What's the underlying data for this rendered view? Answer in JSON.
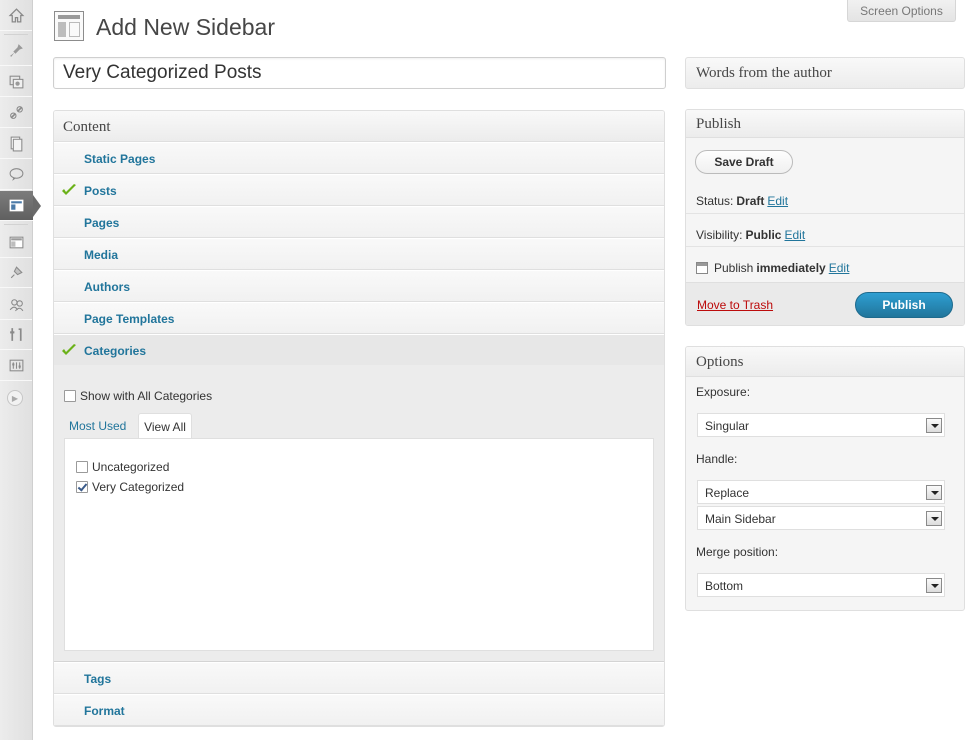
{
  "header": {
    "title": "Add New Sidebar",
    "screen_options": "Screen Options"
  },
  "title_input": {
    "value": "Very Categorized Posts"
  },
  "content_box": {
    "title": "Content",
    "rows": [
      {
        "label": "Static Pages",
        "checked": false
      },
      {
        "label": "Posts",
        "checked": true
      },
      {
        "label": "Pages",
        "checked": false
      },
      {
        "label": "Media",
        "checked": false
      },
      {
        "label": "Authors",
        "checked": false
      },
      {
        "label": "Page Templates",
        "checked": false
      },
      {
        "label": "Categories",
        "checked": true
      },
      {
        "label": "Tags",
        "checked": false
      },
      {
        "label": "Format",
        "checked": false
      }
    ],
    "categories": {
      "show_all_label": "Show with All Categories",
      "tab_most_used": "Most Used",
      "tab_view_all": "View All",
      "items": [
        {
          "label": "Uncategorized",
          "checked": false
        },
        {
          "label": "Very Categorized",
          "checked": true
        }
      ]
    }
  },
  "words_box": {
    "title": "Words from the author"
  },
  "publish_box": {
    "title": "Publish",
    "save_draft": "Save Draft",
    "status_label": "Status:",
    "status_value": "Draft",
    "visibility_label": "Visibility:",
    "visibility_value": "Public",
    "schedule_label": "Publish",
    "schedule_value": "immediately",
    "edit_link": "Edit",
    "trash_link": "Move to Trash",
    "publish_button": "Publish"
  },
  "options_box": {
    "title": "Options",
    "exposure_label": "Exposure:",
    "exposure_value": "Singular",
    "handle_label": "Handle:",
    "handle_value": "Replace",
    "sidebar_value": "Main Sidebar",
    "merge_label": "Merge position:",
    "merge_value": "Bottom"
  },
  "menu_icons": [
    "dashboard-icon",
    "posts-icon",
    "media-icon",
    "links-icon",
    "pages-icon",
    "comments-icon",
    "sidebars-icon",
    "appearance-icon",
    "plugins-icon",
    "users-icon",
    "tools-icon",
    "settings-icon"
  ],
  "colors": {
    "link": "#21759b",
    "check": "#6bb119",
    "trash": "#bc0b0b"
  }
}
